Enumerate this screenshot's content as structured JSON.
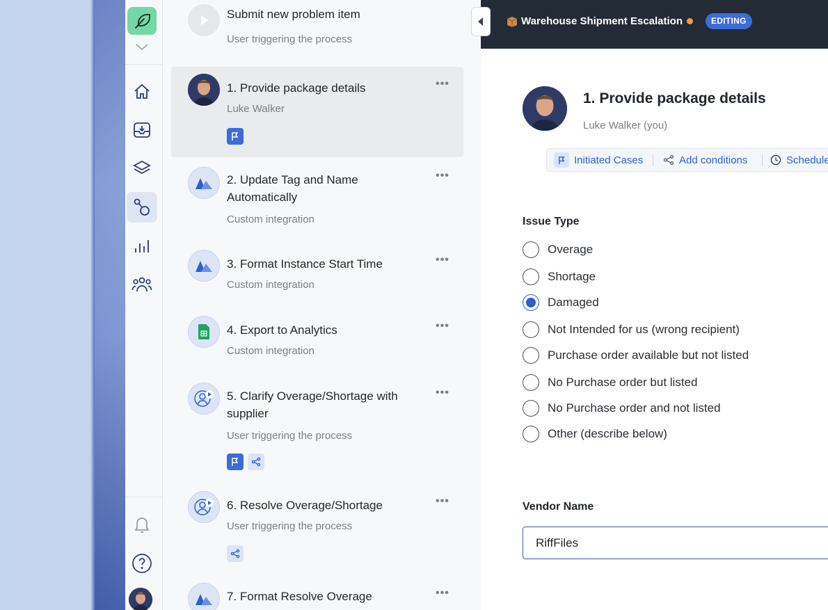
{
  "header": {
    "title": "Warehouse Shipment Escalation",
    "status": "EDITING"
  },
  "steps": [
    {
      "title": "Submit new problem item",
      "subtitle": "User triggering the process"
    },
    {
      "title": "1. Provide package details",
      "subtitle": "Luke Walker"
    },
    {
      "title": "2. Update Tag and Name Automatically",
      "subtitle": "Custom integration"
    },
    {
      "title": "3. Format Instance Start Time",
      "subtitle": "Custom integration"
    },
    {
      "title": "4. Export to Analytics",
      "subtitle": "Custom integration"
    },
    {
      "title": "5. Clarify Overage/Shortage with supplier",
      "subtitle": "User triggering the process"
    },
    {
      "title": "6. Resolve Overage/Shortage",
      "subtitle": "User triggering the process"
    },
    {
      "title": "7. Format Resolve Overage",
      "subtitle": ""
    }
  ],
  "more_label": "•••",
  "detail": {
    "title": "1. Provide package details",
    "user": "Luke Walker (you)",
    "toolbar": {
      "initiated": "Initiated Cases",
      "conditions": "Add conditions",
      "schedule": "Schedule"
    },
    "issue_type": {
      "label": "Issue Type",
      "options": [
        "Overage",
        "Shortage",
        "Damaged",
        "Not Intended for us (wrong recipient)",
        "Purchase order available but not listed",
        "No Purchase order but listed",
        "No Purchase order and not listed",
        "Other (describe below)"
      ],
      "selected": "Damaged"
    },
    "vendor": {
      "label": "Vendor Name",
      "value": "RiffFiles"
    }
  },
  "colors": {
    "accent": "#3f6bd8",
    "header_bg": "#222b36",
    "status_dot": "#f39a3e",
    "logo_bg": "#74d7a6"
  },
  "icons": [
    "home-icon",
    "inbox-icon",
    "layers-icon",
    "process-icon",
    "analytics-icon",
    "team-icon",
    "bell-icon",
    "help-icon"
  ]
}
